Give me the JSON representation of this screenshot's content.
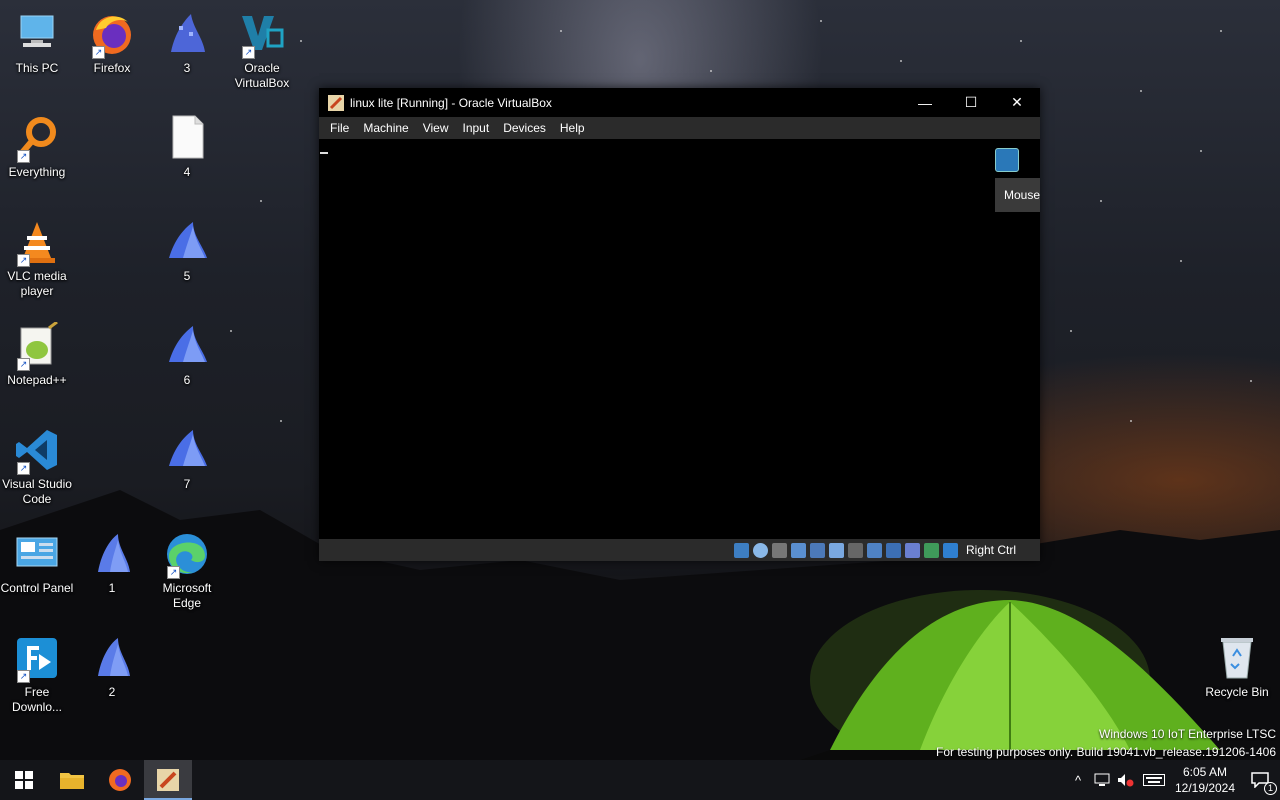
{
  "desktop": {
    "icons": [
      {
        "label": "This PC"
      },
      {
        "label": "Firefox"
      },
      {
        "label": "3"
      },
      {
        "label": "Oracle VirtualBox"
      },
      {
        "label": "Everything"
      },
      {
        "label": "4"
      },
      {
        "label": "VLC media player"
      },
      {
        "label": "5"
      },
      {
        "label": "Notepad++"
      },
      {
        "label": "6"
      },
      {
        "label": "Visual Studio Code"
      },
      {
        "label": "7"
      },
      {
        "label": "Control Panel"
      },
      {
        "label": "1"
      },
      {
        "label": "Microsoft Edge"
      },
      {
        "label": "Free Downlo..."
      },
      {
        "label": "2"
      },
      {
        "label": "Recycle Bin"
      }
    ]
  },
  "vbox": {
    "title": "linux lite [Running] - Oracle VirtualBox",
    "menu": [
      "File",
      "Machine",
      "View",
      "Input",
      "Devices",
      "Help"
    ],
    "tooltip": "Mouse",
    "host_key": "Right Ctrl",
    "controls": {
      "minimize": "—",
      "maximize": "☐",
      "close": "✕"
    }
  },
  "watermark": {
    "line1": "Windows 10 IoT Enterprise LTSC",
    "line2": "For testing purposes only. Build 19041.vb_release.191206-1406"
  },
  "taskbar": {
    "tray": {
      "chevron": "^",
      "time": "6:05 AM",
      "date": "12/19/2024",
      "notifications": "1"
    }
  },
  "colors": {
    "accent": "#7aa8e0",
    "taskbar": "#141519",
    "menubar": "#2b2b2b"
  }
}
